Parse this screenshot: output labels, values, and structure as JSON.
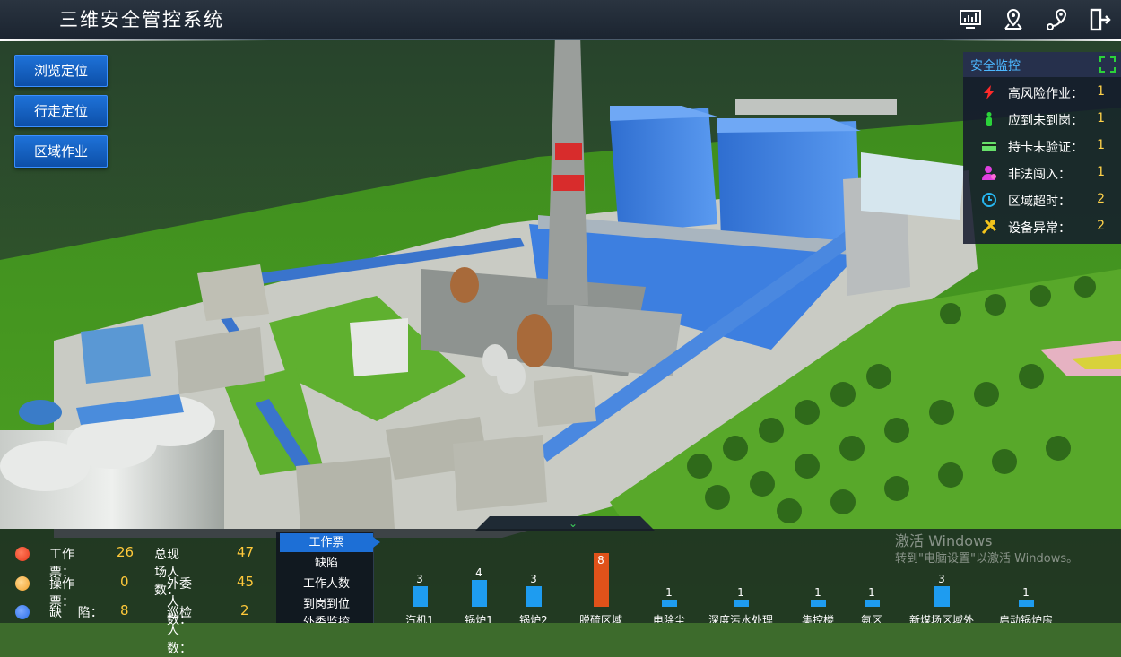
{
  "header": {
    "title": "三维安全管控系统",
    "icons": [
      "monitor-chart-icon",
      "location-pin-icon",
      "route-icon",
      "logout-icon"
    ]
  },
  "nav": {
    "browse_locate": "浏览定位",
    "walk_locate": "行走定位",
    "area_work": "区域作业"
  },
  "security_panel": {
    "title": "安全监控",
    "items": [
      {
        "label": "高风险作业：",
        "value": "1",
        "icon": "lightning-icon",
        "color": "#ff2a2a"
      },
      {
        "label": "应到未到岗：",
        "value": "1",
        "icon": "person-icon",
        "color": "#2bd23a"
      },
      {
        "label": "持卡未验证：",
        "value": "1",
        "icon": "card-icon",
        "color": "#67e06a"
      },
      {
        "label": "非法闯入：",
        "value": "1",
        "icon": "intruder-icon",
        "color": "#e040e0"
      },
      {
        "label": "区域超时：",
        "value": "2",
        "icon": "clock-icon",
        "color": "#27b6f0"
      },
      {
        "label": "设备异常：",
        "value": "2",
        "icon": "tools-icon",
        "color": "#f2c31b"
      }
    ]
  },
  "stats": [
    {
      "label": "工作票：",
      "value": "26",
      "color": "#e8381c"
    },
    {
      "label": "操作票：",
      "value": "0",
      "color": "#f2a02a"
    },
    {
      "label": "缺    陷：",
      "value": "8",
      "color": "#2a6ee8"
    }
  ],
  "people": [
    {
      "label": "总现场人数：",
      "value": "47"
    },
    {
      "label": "外委人数：",
      "value": "45"
    },
    {
      "label": "巡检人数：",
      "value": "2"
    }
  ],
  "tabs": [
    "工作票",
    "缺陷",
    "工作人数",
    "到岗到位",
    "外委监控"
  ],
  "chart_data": {
    "type": "bar",
    "categories": [
      "汽机1",
      "锅炉1",
      "锅炉2",
      "脱硫区域",
      "电除尘",
      "深度污水处理",
      "集控楼",
      "氨区",
      "新煤场区域外",
      "启动锅炉房"
    ],
    "values": [
      3,
      4,
      3,
      8,
      1,
      1,
      1,
      1,
      3,
      1
    ],
    "highlight_index": 3
  },
  "watermark": {
    "line1": "激活 Windows",
    "line2": "转到\"电脑设置\"以激活 Windows。"
  }
}
